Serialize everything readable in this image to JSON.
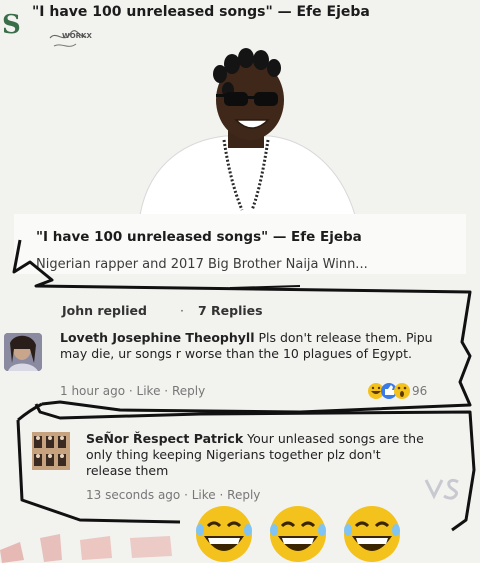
{
  "post": {
    "headline": "\"I have 100 unreleased songs\" — Efe Ejeba",
    "watermark_text": "WORKX",
    "card_title": "\"I have 100 unreleased songs\" — Efe Ejeba",
    "card_subtitle": "Nigerian rapper and 2017 Big Brother Naija Winn..."
  },
  "thread": {
    "replier": "John replied",
    "dot": "·",
    "reply_count": "7 Replies"
  },
  "comments": [
    {
      "author": "Loveth Josephine Theophyll",
      "text": "Pls don't release them. Pipu may die, ur songs r worse than the 10 plagues of Egypt.",
      "time": "1 hour ago",
      "like": "Like",
      "reply": "Reply",
      "reaction_count": "96"
    },
    {
      "author": "SeÑor Řespect Patrick",
      "text": "Your unleased songs are the only thing keeping Nigerians together plz don't release them",
      "time": "13 seconds ago",
      "like": "Like",
      "reply": "Reply"
    }
  ],
  "colors": {
    "accent_green": "#3a6e4a",
    "emoji_yellow": "#f4c21c",
    "like_blue": "#3b7be8",
    "scribble": "#111111"
  },
  "icons": {
    "side_logo": "S",
    "reactions": [
      "laugh-emoji-icon",
      "like-icon",
      "wow-emoji-icon"
    ],
    "sticker_emojis": [
      "laugh-emoji-icon",
      "laugh-emoji-icon",
      "laugh-emoji-icon"
    ]
  }
}
